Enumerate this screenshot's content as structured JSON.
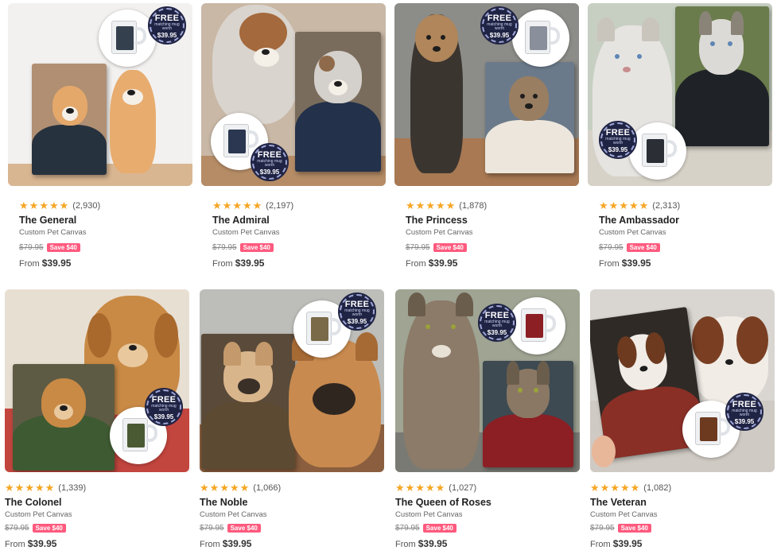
{
  "colors": {
    "star": "#f5a623",
    "save_badge": "#ff5a7e",
    "free_badge": "#1f2344"
  },
  "badge": {
    "free": "FREE",
    "small": "matching mug worth",
    "worth": "$39.95"
  },
  "products": [
    {
      "rating": "(2,930)",
      "title": "The General",
      "subtitle": "Custom Pet Canvas",
      "old_price": "$79.95",
      "save": "Save $40",
      "from": "From",
      "price": "$39.95"
    },
    {
      "rating": "(2,197)",
      "title": "The Admiral",
      "subtitle": "Custom Pet Canvas",
      "old_price": "$79.95",
      "save": "Save $40",
      "from": "From",
      "price": "$39.95"
    },
    {
      "rating": "(1,878)",
      "title": "The Princess",
      "subtitle": "Custom Pet Canvas",
      "old_price": "$79.95",
      "save": "Save $40",
      "from": "From",
      "price": "$39.95"
    },
    {
      "rating": "(2,313)",
      "title": "The Ambassador",
      "subtitle": "Custom Pet Canvas",
      "old_price": "$79.95",
      "save": "Save $40",
      "from": "From",
      "price": "$39.95"
    },
    {
      "rating": "(1,339)",
      "title": "The Colonel",
      "subtitle": "Custom Pet Canvas",
      "old_price": "$79.95",
      "save": "Save $40",
      "from": "From",
      "price": "$39.95"
    },
    {
      "rating": "(1,066)",
      "title": "The Noble",
      "subtitle": "Custom Pet Canvas",
      "old_price": "$79.95",
      "save": "Save $40",
      "from": "From",
      "price": "$39.95"
    },
    {
      "rating": "(1,027)",
      "title": "The Queen of Roses",
      "subtitle": "Custom Pet Canvas",
      "old_price": "$79.95",
      "save": "Save $40",
      "from": "From",
      "price": "$39.95"
    },
    {
      "rating": "(1,082)",
      "title": "The Veteran",
      "subtitle": "Custom Pet Canvas",
      "old_price": "$79.95",
      "save": "Save $40",
      "from": "From",
      "price": "$39.95"
    }
  ]
}
